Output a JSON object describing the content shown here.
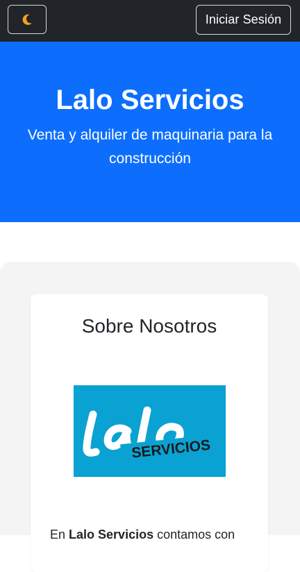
{
  "navbar": {
    "theme_toggle_icon": "moon-icon",
    "login_label": "Iniciar Sesión",
    "colors": {
      "background": "#212529",
      "moon": "#f7a21b"
    }
  },
  "hero": {
    "title": "Lalo Servicios",
    "subtitle": "Venta y alquiler de maquinaria para la construcción",
    "background": "#0d6efd"
  },
  "about": {
    "title": "Sobre Nosotros",
    "logo": {
      "script_text": "Lalo",
      "banner_text": "SERVICIOS",
      "background": "#0aa2d2"
    },
    "text_prefix": "En ",
    "text_brand": "Lalo Servicios",
    "text_suffix": " contamos con"
  }
}
